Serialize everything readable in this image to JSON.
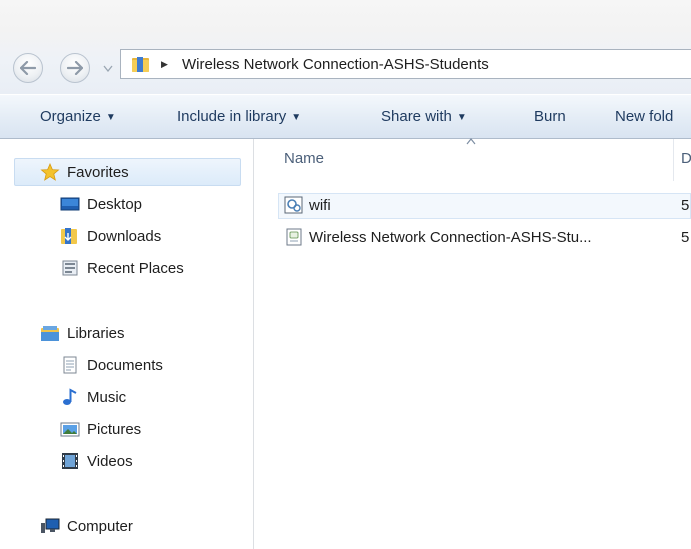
{
  "navigation": {
    "back_icon": "back-arrow-icon",
    "forward_icon": "forward-arrow-icon",
    "history_icon": "chevron-down-icon"
  },
  "address_bar": {
    "folder_icon": "folder-icon",
    "path": "Wireless Network Connection-ASHS-Students"
  },
  "toolbar": {
    "organize": "Organize",
    "include_in_library": "Include in library",
    "share_with": "Share with",
    "burn": "Burn",
    "new_folder": "New fold"
  },
  "nav_pane": {
    "favorites": {
      "label": "Favorites",
      "icon": "star-icon"
    },
    "favorites_items": [
      {
        "label": "Desktop",
        "icon": "desktop-icon"
      },
      {
        "label": "Downloads",
        "icon": "downloads-icon"
      },
      {
        "label": "Recent Places",
        "icon": "recent-places-icon"
      }
    ],
    "libraries": {
      "label": "Libraries",
      "icon": "libraries-icon"
    },
    "library_items": [
      {
        "label": "Documents",
        "icon": "documents-icon"
      },
      {
        "label": "Music",
        "icon": "music-icon"
      },
      {
        "label": "Pictures",
        "icon": "pictures-icon"
      },
      {
        "label": "Videos",
        "icon": "videos-icon"
      }
    ],
    "computer": {
      "label": "Computer",
      "icon": "computer-icon"
    }
  },
  "file_list": {
    "columns": {
      "name": "Name",
      "date": "D"
    },
    "rows": [
      {
        "name": "wifi",
        "date": "5",
        "icon": "wifi-file-icon"
      },
      {
        "name": "Wireless Network Connection-ASHS-Stu...",
        "date": "5",
        "icon": "xml-file-icon"
      }
    ]
  },
  "colors": {
    "toolbar_text": "#1e3a5f",
    "column_header_text": "#4c607a",
    "selection": "#dcebfa"
  }
}
